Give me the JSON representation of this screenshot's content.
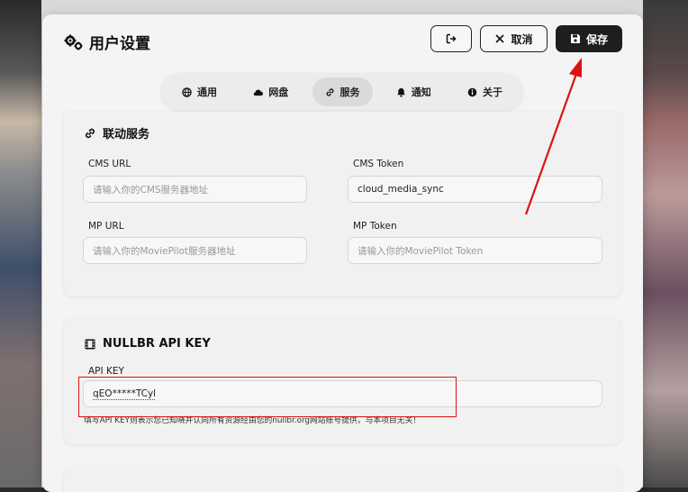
{
  "header": {
    "title": "用户设置",
    "cancel_label": "取消",
    "save_label": "保存"
  },
  "tabs": [
    {
      "label": "通用",
      "icon": "globe-icon"
    },
    {
      "label": "网盘",
      "icon": "cloud-icon"
    },
    {
      "label": "服务",
      "icon": "link-icon",
      "active": true
    },
    {
      "label": "通知",
      "icon": "bell-icon"
    },
    {
      "label": "关于",
      "icon": "info-icon"
    }
  ],
  "linked_services": {
    "title": "联动服务",
    "cms_url_label": "CMS URL",
    "cms_url_placeholder": "请输入你的CMS服务器地址",
    "cms_token_label": "CMS Token",
    "cms_token_value": "cloud_media_sync",
    "mp_url_label": "MP URL",
    "mp_url_placeholder": "请输入你的MoviePilot服务器地址",
    "mp_token_label": "MP Token",
    "mp_token_placeholder": "请输入你的MoviePilot Token"
  },
  "nullbr": {
    "title": "NULLBR API KEY",
    "api_key_label": "API KEY",
    "api_key_value": "qEO*****TCyl",
    "hint": "填写API KEY则表示您已知晓并认同所有资源经由您的nullbr.org网站账号提供，与本项目无关！"
  },
  "colors": {
    "annotation_red": "#dd1111",
    "save_button_bg": "#1e1e1e"
  }
}
